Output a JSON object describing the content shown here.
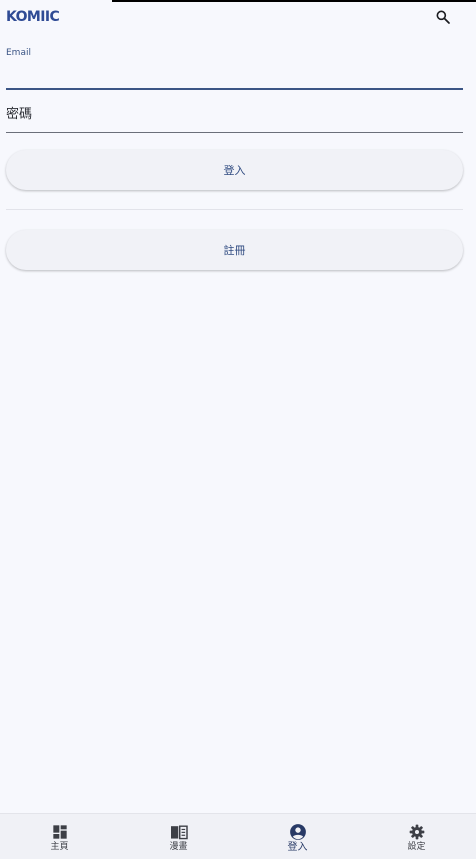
{
  "app_bar": {
    "logo_text": "KOMIIC",
    "logo_color": "#2f4b95",
    "search_icon": "search-icon"
  },
  "form": {
    "email_label": "Email",
    "email_value": "",
    "password_placeholder": "密碼",
    "accent_color": "#3b5585"
  },
  "buttons": {
    "login_label": "登入",
    "register_label": "註冊"
  },
  "bottom_nav": {
    "items": [
      {
        "label": "主頁",
        "icon": "dashboard-icon",
        "active": false
      },
      {
        "label": "漫畫",
        "icon": "book-icon",
        "active": false
      },
      {
        "label": "登入",
        "icon": "account-circle-icon",
        "active": true
      },
      {
        "label": "設定",
        "icon": "gear-icon",
        "active": false
      }
    ]
  }
}
